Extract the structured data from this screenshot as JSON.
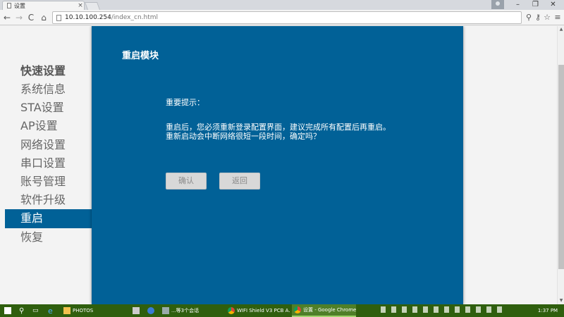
{
  "browser": {
    "tab_title": "设置",
    "tab_close": "×",
    "url_host": "10.10.100.254",
    "url_path": "/index_cn.html",
    "nav_back": "←",
    "nav_forward": "→",
    "nav_reload": "C",
    "nav_home": "⌂",
    "win_min": "–",
    "win_max": "❐",
    "win_close": "✕",
    "icon_zoom": "⚲",
    "icon_key": "⚷",
    "icon_star": "☆",
    "icon_menu": "≡"
  },
  "sidebar": {
    "heading": "快速设置",
    "items": [
      {
        "label": "系统信息",
        "active": false
      },
      {
        "label": "STA设置",
        "active": false
      },
      {
        "label": "AP设置",
        "active": false
      },
      {
        "label": "网络设置",
        "active": false
      },
      {
        "label": "串口设置",
        "active": false
      },
      {
        "label": "账号管理",
        "active": false
      },
      {
        "label": "软件升级",
        "active": false
      },
      {
        "label": "重启",
        "active": true
      },
      {
        "label": "恢复",
        "active": false
      }
    ]
  },
  "panel": {
    "title": "重启模块",
    "notice_title": "重要提示：",
    "notice_line1": "重启后，您必须重新登录配置界面，建议完成所有配置后再重启。",
    "notice_line2": "重新启动会中断网络很短一段时间，确定吗？",
    "confirm_label": "确认",
    "back_label": "返回",
    "background_color": "#016197"
  },
  "taskbar": {
    "photos": "PHOTOS",
    "chat": "...等3个会话",
    "chrome_window1": "WIFI Shield V3 PCB A...",
    "chrome_window2": "设置 - Google Chrome",
    "clock": "1:37 PM",
    "color": "#2f5f0e"
  }
}
